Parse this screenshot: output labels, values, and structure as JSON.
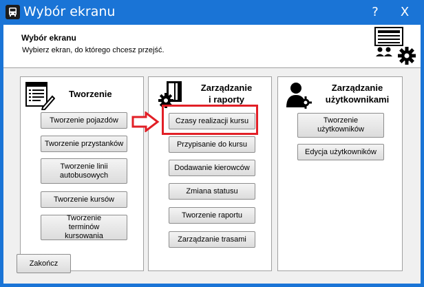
{
  "window": {
    "title": "Wybór ekranu",
    "help_label": "?",
    "close_label": "X",
    "colors": {
      "titlebar": "#1a74d6",
      "highlight": "#e21f26"
    }
  },
  "header": {
    "title": "Wybór ekranu",
    "subtitle": "Wybierz ekran, do którego chcesz przejść."
  },
  "panels": {
    "creation": {
      "title": "Tworzenie",
      "buttons": [
        "Tworzenie pojazdów",
        "Tworzenie przystanków",
        "Tworzenie linii autobusowych",
        "Tworzenie kursów",
        "Tworzenie terminów kursowania"
      ]
    },
    "reports": {
      "title_line1": "Zarządzanie",
      "title_line2": "i raporty",
      "buttons": [
        "Czasy realizacji kursu",
        "Przypisanie do kursu",
        "Dodawanie kierowców",
        "Zmiana statusu",
        "Tworzenie raportu",
        "Zarządzanie trasami"
      ]
    },
    "users": {
      "title_line1": "Zarządzanie",
      "title_line2": "użytkownikami",
      "buttons": [
        "Tworzenie użytkowników",
        "Edycja użytkowników"
      ]
    }
  },
  "footer": {
    "exit_label": "Zakończ"
  },
  "icons": {
    "app": "bus-icon",
    "header": "screen-users-gear-icon",
    "creation": "document-pencil-icon",
    "reports": "door-gear-icon",
    "users": "user-gear-icon",
    "pointer": "right-arrow-icon"
  }
}
